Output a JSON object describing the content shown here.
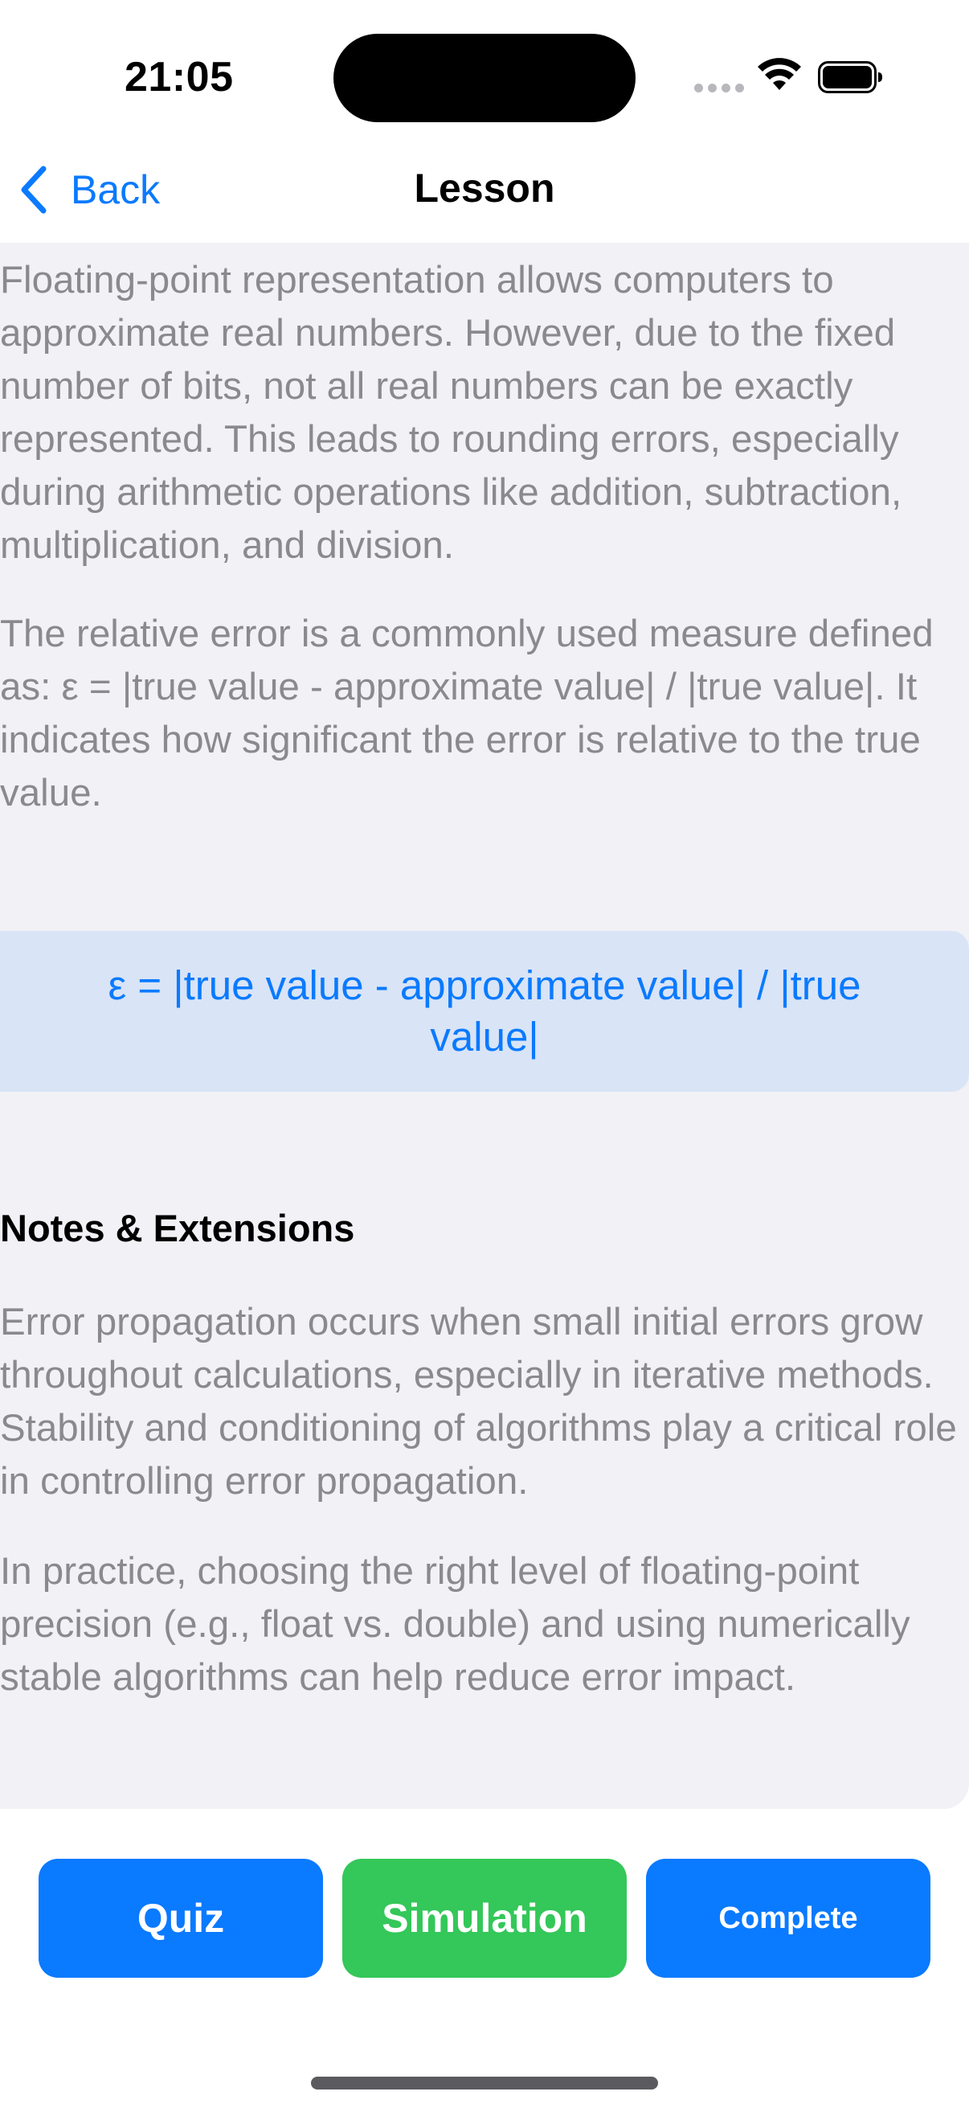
{
  "status_bar": {
    "time": "21:05"
  },
  "nav": {
    "back_label": "Back",
    "title": "Lesson"
  },
  "lesson": {
    "paragraph_1": "Floating-point representation allows computers to approximate real numbers. However, due to the fixed number of bits, not all real numbers can be exactly represented. This leads to rounding errors, especially during arithmetic operations like addition, subtraction, multiplication, and division.",
    "paragraph_2": "The relative error is a commonly used measure defined as: ε = |true value - approximate value| / |true value|. It indicates how significant the error is relative to the true value.",
    "formula": "ε = |true value - approximate value| / |true value|",
    "notes_heading": "Notes & Extensions",
    "paragraph_3": "Error propagation occurs when small initial errors grow throughout calculations, especially in iterative methods. Stability and conditioning of algorithms play a critical role in controlling error propagation.",
    "paragraph_4": "In practice, choosing the right level of floating-point precision (e.g., float vs. double) and using numerically stable algorithms can help reduce error impact."
  },
  "actions": {
    "quiz_label": "Quiz",
    "simulation_label": "Simulation",
    "complete_label": "Complete"
  },
  "colors": {
    "accent_blue": "#0a7aff",
    "accent_green": "#34c759",
    "content_background": "#f1f1f6",
    "formula_background": "#d9e4f6",
    "body_text": "#8a8a8e"
  },
  "icons": {
    "back": "chevron-left-icon",
    "signal": "cellular-signal-icon",
    "wifi": "wifi-icon",
    "battery": "battery-icon"
  }
}
